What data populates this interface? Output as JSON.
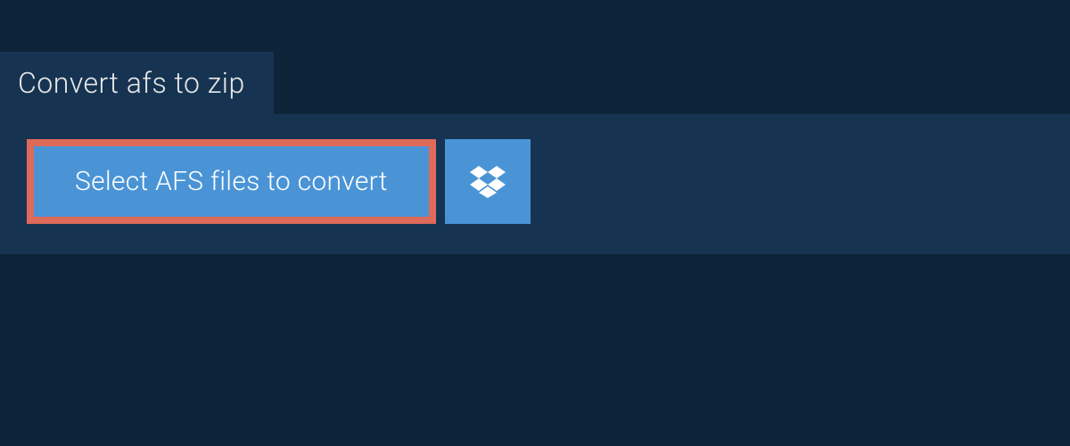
{
  "tab": {
    "label": "Convert afs to zip"
  },
  "actions": {
    "select_label": "Select AFS files to convert"
  },
  "colors": {
    "bg": "#0d2438",
    "panel": "#163452",
    "button": "#4a94d6",
    "highlight_border": "#de6a5a",
    "text": "#ffffff"
  }
}
